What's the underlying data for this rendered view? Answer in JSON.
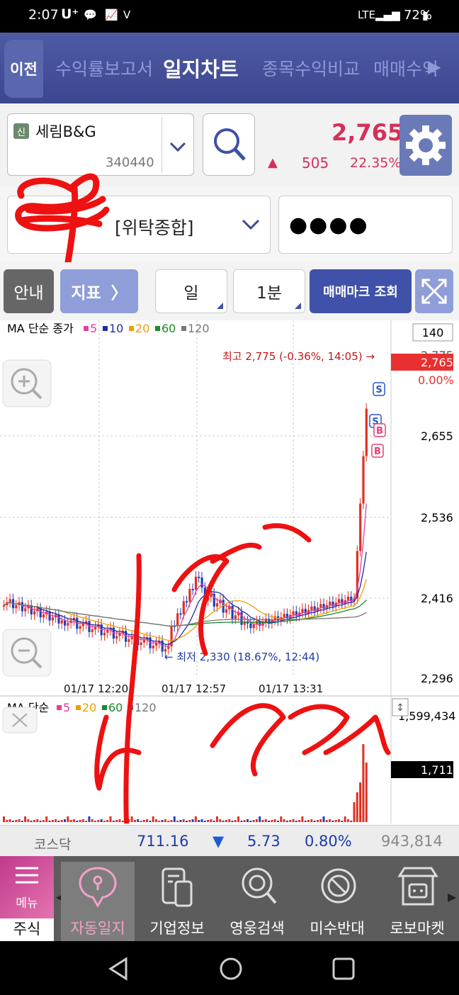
{
  "status_bar": {
    "time": "2:07",
    "carrier": "U⁺",
    "battery": "72%"
  },
  "top_nav": {
    "back": "이전",
    "tabs": [
      "수익률보고서",
      "일지차트",
      "종목수익비교",
      "매매수익"
    ],
    "active": 1,
    "more": "▶"
  },
  "stock": {
    "badge": "신",
    "name": "세림B&G",
    "code": "340440",
    "price": "2,765",
    "change": "505",
    "rate": "22.35%"
  },
  "account": {
    "name": "[위탁종합]",
    "password_mask": "●●●●"
  },
  "toolbar": {
    "info": "안내",
    "indicator": "지표",
    "period": "일",
    "interval": "1분",
    "trade_mark": "매매마크 조회"
  },
  "chart": {
    "legend_main": {
      "prefix": "MA 단순 종가",
      "ma": [
        {
          "n": "5",
          "color": "#e040a0"
        },
        {
          "n": "10",
          "color": "#1c2fa8"
        },
        {
          "n": "20",
          "color": "#f0a000"
        },
        {
          "n": "60",
          "color": "#1a8a2a"
        },
        {
          "n": "120",
          "color": "#777777"
        }
      ]
    },
    "legend_vol": {
      "prefix": "MA 단순",
      "ma": [
        {
          "n": "5",
          "color": "#e040a0"
        },
        {
          "n": "20",
          "color": "#f0a000"
        },
        {
          "n": "60",
          "color": "#1a8a2a"
        },
        {
          "n": "120",
          "color": "#777777"
        }
      ]
    },
    "count_box": "140",
    "price_labels": [
      "2,775",
      "2,655",
      "2,536",
      "2,416",
      "2,296"
    ],
    "current_price": "2,765",
    "current_rate": "0.00%",
    "high_note": "최고 2,775 (-0.36%, 14:05) →",
    "low_note": "← 최저 2,330 (18.67%, 12:44)",
    "time_labels": [
      "01/17 12:20",
      "01/17 12:57",
      "01/17 13:31"
    ],
    "vol_max": "1,599,434",
    "vol_cur": "1,711",
    "marks": [
      "S",
      "S",
      "B",
      "B"
    ],
    "colors": {
      "up": "#e03020",
      "down": "#2040c0",
      "price_box": "#e83030"
    }
  },
  "index_bar": {
    "name": "코스닥",
    "value": "711.16",
    "arrow": "▼",
    "change": "5.73",
    "rate": "0.80%",
    "volume": "943,814"
  },
  "bottom_nav": {
    "menu": "메뉴",
    "stock": "주식",
    "items": [
      "자동일지",
      "기업정보",
      "영웅검색",
      "미수반대",
      "로보마켓"
    ],
    "active": 0
  }
}
